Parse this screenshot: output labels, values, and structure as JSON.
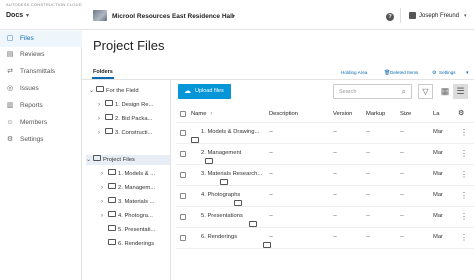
{
  "topbar": {
    "brand": "AUTODESK CONSTRUCTION CLOUD",
    "module": "Docs",
    "project": "Microol Resources East Residence Hall",
    "user": "Joseph Freund"
  },
  "sidebar": {
    "items": [
      {
        "label": "Files",
        "icon": "file-icon",
        "glyph": "▢"
      },
      {
        "label": "Reviews",
        "icon": "review-icon",
        "glyph": "▤"
      },
      {
        "label": "Transmittals",
        "icon": "transmittal-icon",
        "glyph": "⇄"
      },
      {
        "label": "Issues",
        "icon": "issue-icon",
        "glyph": "◎"
      },
      {
        "label": "Reports",
        "icon": "report-icon",
        "glyph": "▥"
      },
      {
        "label": "Members",
        "icon": "members-icon",
        "glyph": "☺"
      },
      {
        "label": "Settings",
        "icon": "gear-icon",
        "glyph": "⚙"
      }
    ]
  },
  "main": {
    "title": "Project Files",
    "tab": "Folders",
    "links": {
      "holding": "Holding Area",
      "deleted": "Deleted Items",
      "settings": "Settings"
    },
    "upload": "Upload files",
    "search_placeholder": "Search"
  },
  "tree": {
    "for_field": "For the Field",
    "field_children": [
      "1. Design Re...",
      "2. Bid Packa...",
      "3. Constructi..."
    ],
    "project_files": "Project Files",
    "project_children": [
      "1. Models & ...",
      "2. Managem...",
      "3. Materials ...",
      "4. Photogra...",
      "5. Presentati...",
      "6. Renderings"
    ]
  },
  "table": {
    "headers": {
      "name": "Name",
      "description": "Description",
      "version": "Version",
      "markup": "Markup",
      "size": "Size",
      "last": "La"
    },
    "rows": [
      {
        "name": "1. Models & Drawing...",
        "description": "--",
        "version": "--",
        "markup": "--",
        "size": "--",
        "last": "Mar"
      },
      {
        "name": "2. Management",
        "description": "--",
        "version": "--",
        "markup": "--",
        "size": "--",
        "last": "Mar"
      },
      {
        "name": "3. Materials Research...",
        "description": "--",
        "version": "--",
        "markup": "--",
        "size": "--",
        "last": "Mar"
      },
      {
        "name": "4. Photographs",
        "description": "--",
        "version": "--",
        "markup": "--",
        "size": "--",
        "last": "Mar"
      },
      {
        "name": "5. Presentations",
        "description": "--",
        "version": "--",
        "markup": "--",
        "size": "--",
        "last": "Mar"
      },
      {
        "name": "6. Renderings",
        "description": "--",
        "version": "--",
        "markup": "--",
        "size": "--",
        "last": "Mar"
      }
    ]
  },
  "colors": {
    "accent": "#0696d7",
    "link": "#0a6ab3",
    "active_bg": "#eef5fb"
  }
}
